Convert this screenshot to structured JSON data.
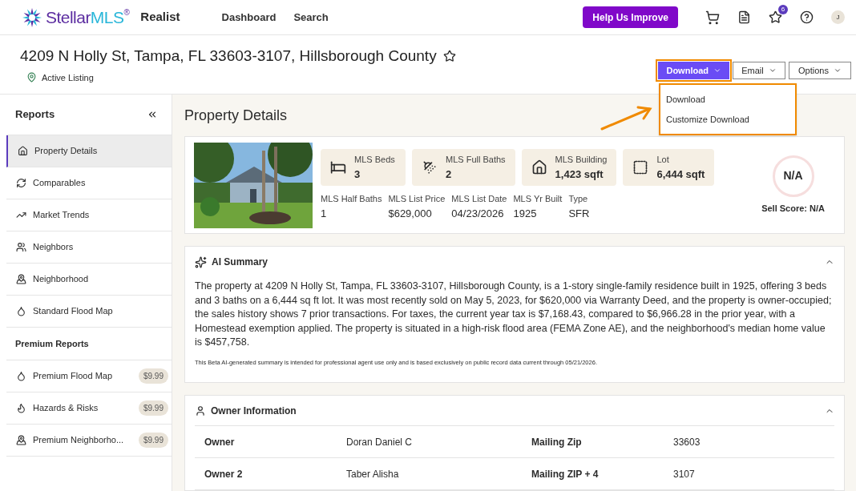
{
  "header": {
    "logo": {
      "word": "Stellar",
      "suffix": "MLS",
      "mark": "®"
    },
    "product": "Realist",
    "nav": [
      "Dashboard",
      "Search"
    ],
    "feedback_button": "Help Us Improve",
    "favorites_badge": "6",
    "avatar": "J"
  },
  "property": {
    "address": "4209 N Holly St, Tampa, FL 33603-3107, Hillsborough County",
    "favorite": false,
    "status": "Active Listing"
  },
  "actions": [
    {
      "label": "Download",
      "selected": true
    },
    {
      "label": "Email",
      "selected": false
    },
    {
      "label": "Options",
      "selected": false
    }
  ],
  "download_menu": [
    "Download",
    "Customize Download"
  ],
  "sidebar": {
    "title": "Reports",
    "items": [
      {
        "label": "Property Details",
        "selected": true
      },
      {
        "label": "Comparables",
        "selected": false
      },
      {
        "label": "Market Trends",
        "selected": false
      },
      {
        "label": "Neighbors",
        "selected": false
      },
      {
        "label": "Neighborhood",
        "selected": false
      },
      {
        "label": "Standard Flood Map",
        "selected": false
      }
    ],
    "premium_title": "Premium Reports",
    "premium_items": [
      {
        "label": "Premium Flood Map",
        "price": "$9.99"
      },
      {
        "label": "Hazards & Risks",
        "price": "$9.99"
      },
      {
        "label": "Premium Neighborho...",
        "price": "$9.99"
      }
    ]
  },
  "page_title": "Property Details",
  "summary_card": {
    "tiles": [
      {
        "label": "MLS Beds",
        "value": "3"
      },
      {
        "label": "MLS Full Baths",
        "value": "2"
      },
      {
        "label": "MLS Building",
        "value": "1,423 sqft"
      },
      {
        "label": "Lot",
        "value": "6,444 sqft"
      }
    ],
    "facts": [
      {
        "label": "MLS Half Baths",
        "value": "1"
      },
      {
        "label": "MLS List Price",
        "value": "$629,000"
      },
      {
        "label": "MLS List Date",
        "value": "04/23/2026"
      },
      {
        "label": "MLS Yr Built",
        "value": "1925"
      },
      {
        "label": "Type",
        "value": "SFR"
      }
    ],
    "score": "N/A",
    "score_label": "Sell Score: N/A"
  },
  "ai_summary": {
    "title": "AI Summary",
    "expanded": true,
    "text": "The property at 4209 N Holly St, Tampa, FL 33603-3107, Hillsborough County, is a 1-story single-family residence built in 1925, offering 3 beds and 3 baths on a 6,444 sq ft lot. It was most recently sold on May 5, 2023, for $620,000 via Warranty Deed, and the property is owner-occupied; the sales history shows 7 prior transactions. For taxes, the current year tax is $7,168.43, compared to $6,966.28 in the prior year, with a Homestead exemption applied. The property is situated in a high-risk flood area (FEMA Zone AE), and the neighborhood's median home value is $457,758.",
    "disclaimer": "This Beta AI-generated summary is intended for professional agent use only and is based exclusively on public record data current through 05/21/2026."
  },
  "owner_info": {
    "title": "Owner Information",
    "expanded": true,
    "rows": [
      [
        "Owner",
        "Doran Daniel C",
        "Mailing Zip",
        "33603"
      ],
      [
        "Owner 2",
        "Taber Alisha",
        "Mailing ZIP + 4",
        "3107"
      ]
    ]
  }
}
